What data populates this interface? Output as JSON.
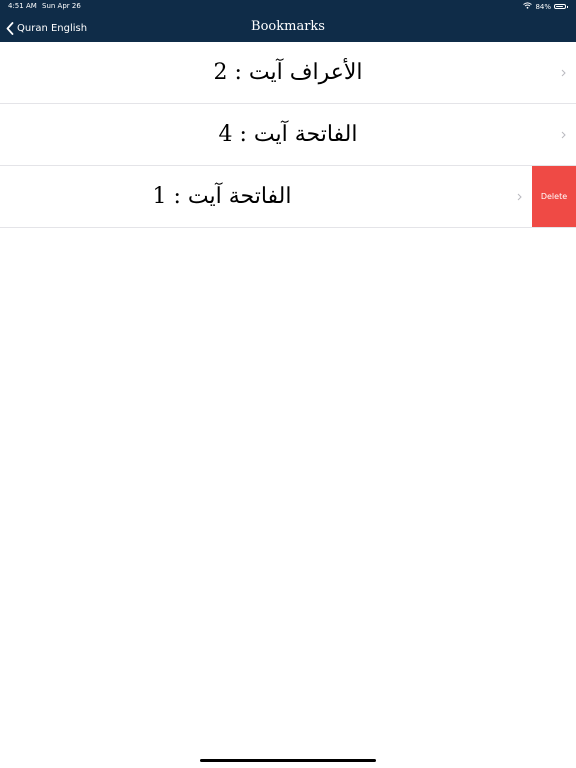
{
  "status_bar": {
    "time": "4:51 AM",
    "date": "Sun Apr 26",
    "battery": "84%",
    "battery_level": 0.84
  },
  "nav_bar": {
    "back_label": "Quran English",
    "title": "Bookmarks",
    "background_color": "#0f2c48"
  },
  "bookmarks": [
    {
      "label": "الأعراف آيت : 2"
    },
    {
      "label": "الفاتحة آيت : 4"
    },
    {
      "label": "الفاتحة آيت : 1",
      "delete_label": "Delete"
    }
  ],
  "colors": {
    "delete": "#ef4a45",
    "chevron": "#b9b9bf"
  },
  "icons": [
    "wifi-icon",
    "battery-icon",
    "chevron-left-icon",
    "chevron-right-icon"
  ]
}
